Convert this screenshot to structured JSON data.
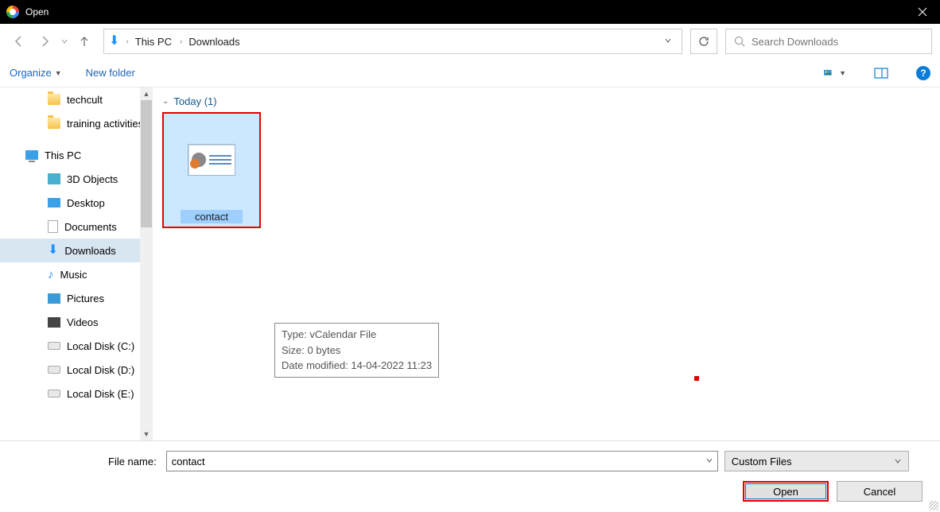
{
  "titlebar": {
    "title": "Open"
  },
  "nav": {
    "breadcrumb": [
      "This PC",
      "Downloads"
    ],
    "search_placeholder": "Search Downloads"
  },
  "toolbar": {
    "organize": "Organize",
    "newfolder": "New folder"
  },
  "sidebar": {
    "top": [
      {
        "label": "techcult",
        "icon": "folder"
      },
      {
        "label": "training activities",
        "icon": "folder"
      }
    ],
    "thispc_label": "This PC",
    "thispc": [
      {
        "label": "3D Objects",
        "icon": "3d"
      },
      {
        "label": "Desktop",
        "icon": "desktop"
      },
      {
        "label": "Documents",
        "icon": "doc"
      },
      {
        "label": "Downloads",
        "icon": "dl",
        "selected": true
      },
      {
        "label": "Music",
        "icon": "music"
      },
      {
        "label": "Pictures",
        "icon": "pic"
      },
      {
        "label": "Videos",
        "icon": "vid"
      },
      {
        "label": "Local Disk (C:)",
        "icon": "disk"
      },
      {
        "label": "Local Disk (D:)",
        "icon": "disk"
      },
      {
        "label": "Local Disk (E:)",
        "icon": "disk"
      }
    ]
  },
  "content": {
    "group_label": "Today (1)",
    "tile_label": "contact",
    "tooltip": {
      "line1": "Type: vCalendar File",
      "line2": "Size: 0 bytes",
      "line3": "Date modified: 14-04-2022 11:23"
    }
  },
  "footer": {
    "filename_label": "File name:",
    "filename_value": "contact",
    "filter": "Custom Files",
    "open": "Open",
    "cancel": "Cancel"
  }
}
